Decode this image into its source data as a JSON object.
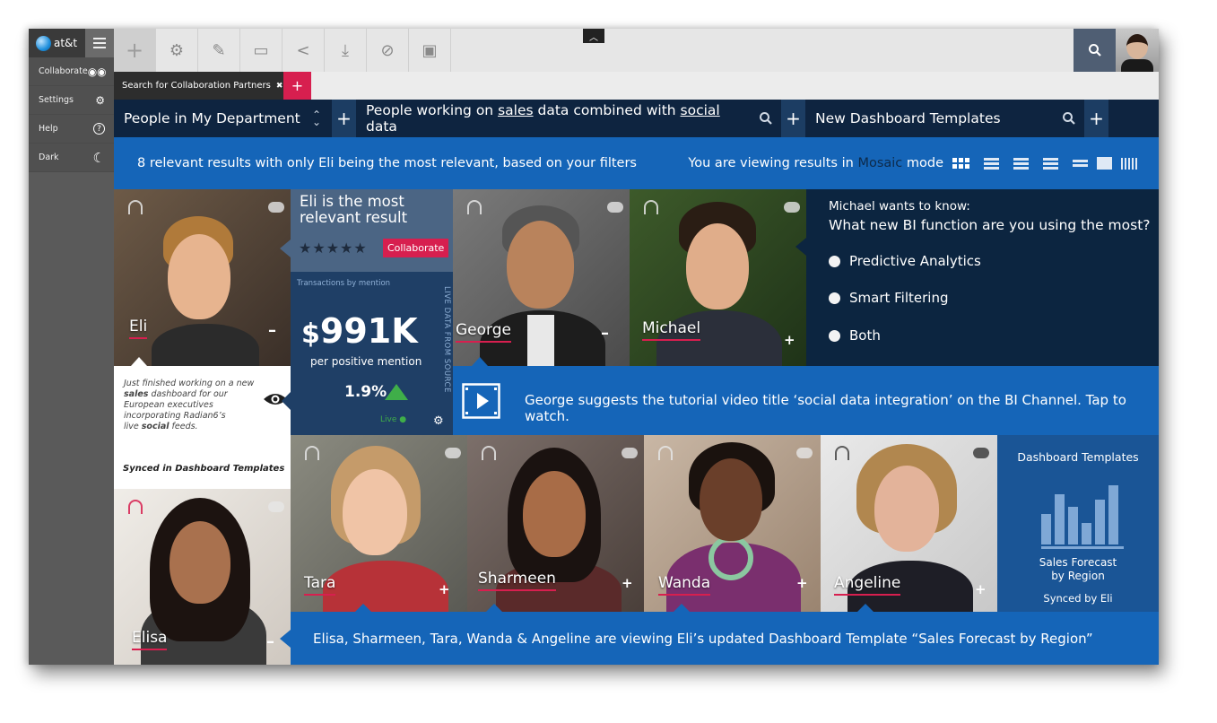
{
  "sidebar": {
    "logo": "at&t",
    "items": [
      {
        "label": "Collaborate",
        "icon": "people-icon",
        "glyph": "👥"
      },
      {
        "label": "Settings",
        "icon": "gears-icon",
        "glyph": "⚙"
      },
      {
        "label": "Help",
        "icon": "help-icon",
        "glyph": "?"
      },
      {
        "label": "Dark",
        "icon": "moon-icon",
        "glyph": "☾"
      }
    ]
  },
  "toolbar": {
    "icons": [
      {
        "name": "add-icon",
        "glyph": "+"
      },
      {
        "name": "gear-icon",
        "glyph": "⚙"
      },
      {
        "name": "pencil-icon",
        "glyph": "✎"
      },
      {
        "name": "comment-icon",
        "glyph": "▭"
      },
      {
        "name": "share-icon",
        "glyph": "<"
      },
      {
        "name": "download-icon",
        "glyph": "⤓"
      },
      {
        "name": "link-icon",
        "glyph": "⊘"
      },
      {
        "name": "devices-icon",
        "glyph": "▣"
      }
    ],
    "collapse_glyph": "︿",
    "search_glyph": "🔍"
  },
  "tabs": {
    "active_label": "Search for Collaboration Partners",
    "close_glyph": "✖",
    "add_glyph": "+"
  },
  "filters": {
    "seg1": "People in My Department",
    "seg2_a": "People working on ",
    "seg2_b": "sales",
    "seg2_c": " data combined with ",
    "seg2_d": "social",
    "seg2_e": " data",
    "seg3": "New Dashboard Templates",
    "plus": "+",
    "updown_glyph": "⌃⌄",
    "search_glyph": "🔍"
  },
  "results": {
    "summary": "8 relevant results with only Eli being the most relevant, based on your filters",
    "viewing_prefix": "You are viewing results in",
    "mode": "Mosaic",
    "viewing_suffix": "mode"
  },
  "eli": {
    "name": "Eli",
    "headline_1": "Eli is the most",
    "headline_2": "relevant result",
    "stars": "★★★★★",
    "collaborate": "Collaborate",
    "comment_1": "Just finished working on a new",
    "comment_2a": "sales",
    "comment_2b": " dashboard for our",
    "comment_3": "European executives",
    "comment_4": "incorporating Radian6’s",
    "comment_5a": "live ",
    "comment_5b": "social",
    "comment_5c": " feeds.",
    "synced": "Synced in Dashboard Templates"
  },
  "stat": {
    "caption": "Transactions by mention",
    "currency": "$",
    "value": "991K",
    "sub": "per positive mention",
    "pct": "1.9%",
    "live": "Live",
    "vertical": "LIVE DATA FROM SOURCE"
  },
  "people": {
    "george": "George",
    "michael": "Michael",
    "tara": "Tara",
    "sharmeen": "Sharmeen",
    "wanda": "Wanda",
    "angeline": "Angeline",
    "elisa": "Elisa"
  },
  "poll": {
    "asker": "Michael wants to know:",
    "question": "What new BI function are you using the most?",
    "options": [
      "Predictive Analytics",
      "Smart Filtering",
      "Both"
    ]
  },
  "suggestion": "George suggests the tutorial video title ‘social data integration’ on the BI Channel. Tap to watch.",
  "templates": {
    "title": "Dashboard Templates",
    "chart_1": "Sales Forecast",
    "chart_2": "by Region",
    "synced": "Synced by Eli"
  },
  "footer": "Elisa, Sharmeen, Tara, Wanda & Angeline are viewing Eli’s updated Dashboard Template “Sales Forecast by Region”",
  "colors": {
    "accent": "#d71f4f",
    "blue": "#1565b8",
    "navy": "#0e2440",
    "green": "#3fae49"
  }
}
